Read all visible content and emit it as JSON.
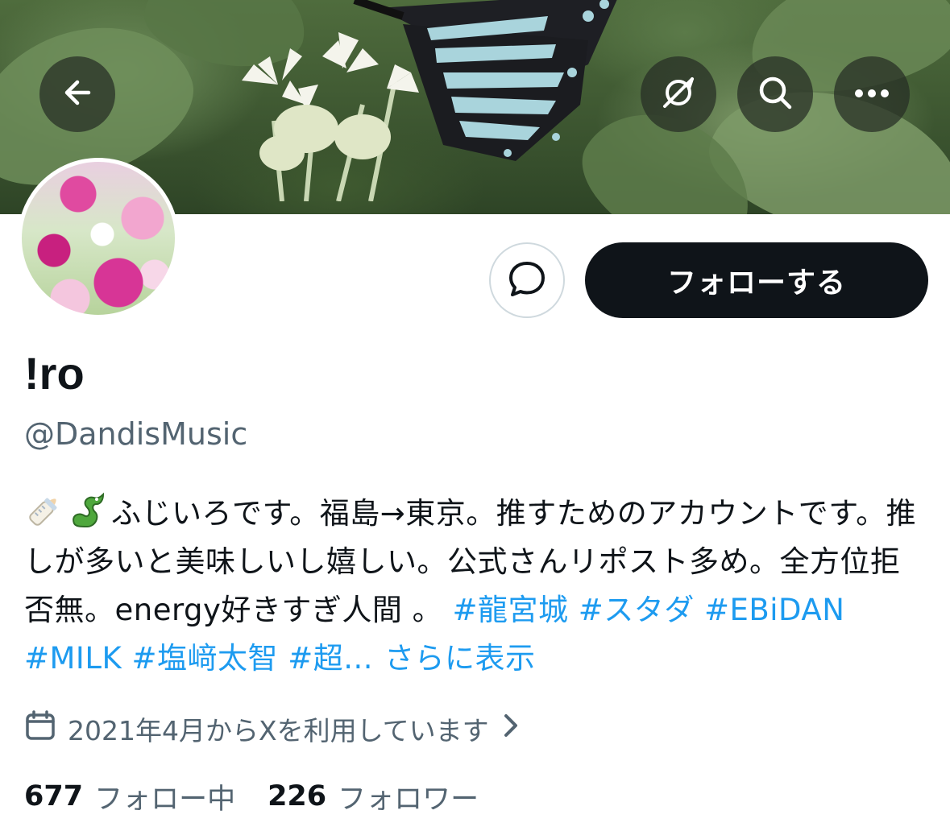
{
  "header": {
    "back_icon": "arrow-left-icon",
    "grok_icon": "grok-icon",
    "search_icon": "search-icon",
    "more_icon": "more-horizontal-icon"
  },
  "profile": {
    "display_name": "!ro",
    "handle": "@DandisMusic",
    "follow_label": "フォローする",
    "message_icon": "message-bubble-icon"
  },
  "bio": {
    "emojis": [
      "baby-bottle-emoji",
      "dragon-emoji"
    ],
    "text": "ふじいろです。福島→東京。推すためのアカウントです。推しが多いと美味しいし嬉しい。公式さんリポスト多め。全方位拒否無。energy好きすぎ人間 。 ",
    "hashtags": [
      "#龍宮城",
      "#スタダ",
      "#EBiDAN",
      "#MILK",
      "#塩﨑太智",
      "#超..."
    ],
    "show_more": "さらに表示"
  },
  "joined": {
    "text": "2021年4月からXを利用しています",
    "icon": "calendar-icon"
  },
  "stats": {
    "following_count": "677",
    "following_label": "フォロー中",
    "followers_count": "226",
    "followers_label": "フォロワー"
  },
  "colors": {
    "link": "#1d9bf0",
    "secondary_text": "#536471",
    "primary_text": "#0f1419",
    "follow_button": "#0f1419"
  }
}
